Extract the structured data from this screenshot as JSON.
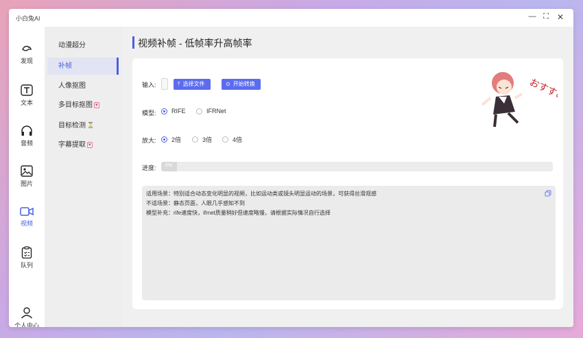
{
  "app": {
    "title": "小白兔AI"
  },
  "window_controls": {
    "minimize": "—",
    "maximize": "⛶",
    "close": "✕"
  },
  "left_nav": [
    {
      "label": "发现",
      "icon": "discover-icon"
    },
    {
      "label": "文本",
      "icon": "text-icon"
    },
    {
      "label": "音频",
      "icon": "headphones-icon"
    },
    {
      "label": "图片",
      "icon": "image-icon"
    },
    {
      "label": "视频",
      "icon": "video-icon",
      "active": true
    },
    {
      "label": "队列",
      "icon": "clipboard-icon"
    },
    {
      "label": "个人中心",
      "icon": "user-icon"
    }
  ],
  "sub_nav": [
    {
      "label": "动漫超分"
    },
    {
      "label": "补帧",
      "active": true
    },
    {
      "label": "人像抠图"
    },
    {
      "label": "多目标抠图",
      "badge": "▾"
    },
    {
      "label": "目标检测",
      "badge": "⌛"
    },
    {
      "label": "字幕提取",
      "badge": "▾"
    }
  ],
  "page": {
    "title": "视频补帧 - 低帧率升高帧率"
  },
  "form": {
    "input_label": "输入:",
    "select_file_button": "选择文件",
    "start_button": "开始转换",
    "model_label": "模型:",
    "model_options": [
      "RIFE",
      "IFRNet"
    ],
    "model_selected": "RIFE",
    "scale_label": "放大:",
    "scale_options": [
      "2倍",
      "3倍",
      "4倍"
    ],
    "scale_selected": "2倍",
    "progress_label": "进度:",
    "progress_text": "0%",
    "progress_value": 0
  },
  "description": {
    "lines": [
      "适用场景：特别适合动态变化明显的视频，比如运动类或镜头明显运动的场景，可获得丝滑观感",
      "不适场景：静态页面，人眼几乎感知不到",
      "模型补充：rife速度快，ifrnet质量稍好但速度略慢，请根据实际情况自行选择"
    ]
  },
  "mascot": {
    "caption": "おすすめ!"
  },
  "colors": {
    "accent": "#4a5fe0",
    "button": "#5b6cf0"
  }
}
